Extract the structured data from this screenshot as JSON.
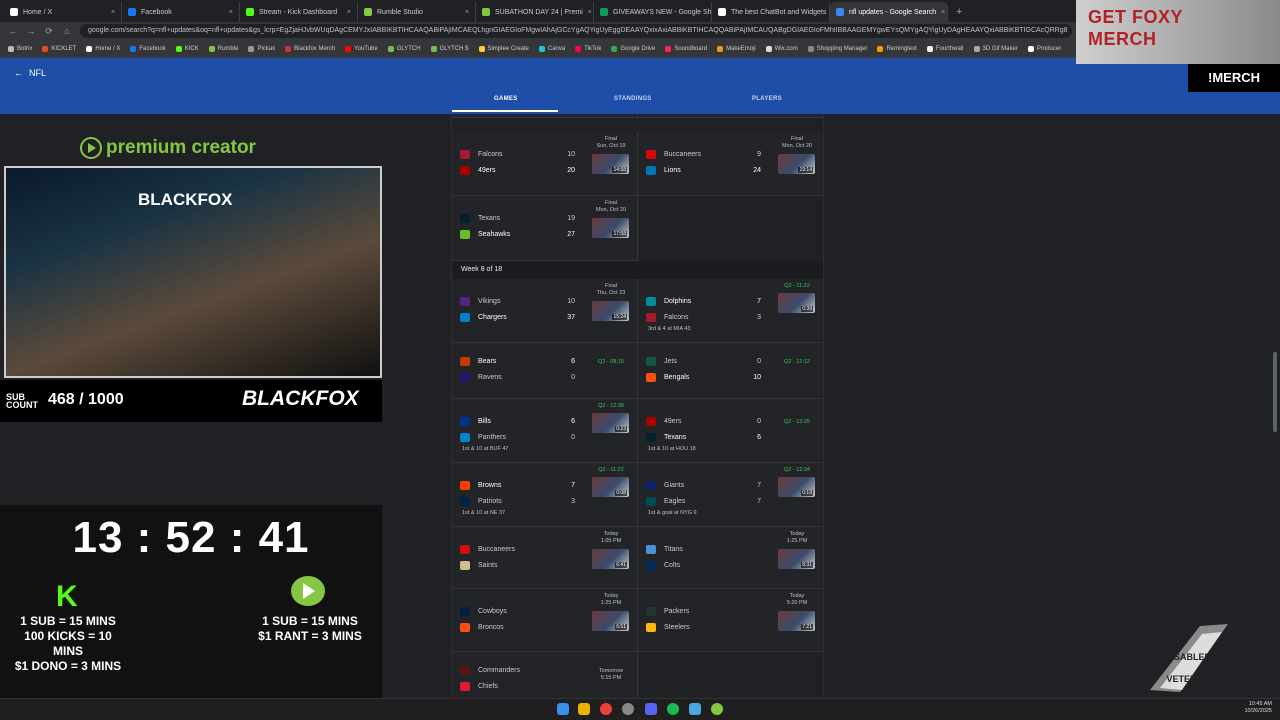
{
  "browser": {
    "tabs": [
      {
        "label": "Home / X",
        "color": "#ffffff"
      },
      {
        "label": "Facebook",
        "color": "#1877f2"
      },
      {
        "label": "Stream - Kick Dashboard",
        "color": "#53fc18"
      },
      {
        "label": "Rumble Studio",
        "color": "#85c742"
      },
      {
        "label": "SUBATHON DAY 24 | Premi",
        "color": "#85c742"
      },
      {
        "label": "GIVEAWAYS NEW - Google She",
        "color": "#0f9d58"
      },
      {
        "label": "The best ChatBot and Widgets",
        "color": "#ffffff"
      },
      {
        "label": "nfl updates - Google Search",
        "color": "#4285f4"
      }
    ],
    "url": "google.com/search?q=nfl+updates&oq=nfl+updates&gs_lcrp=EgZjaHJvbWUqDAgCEMYJxIABBIKBTIHCAAQABiPAjIMCAEQLhgnGIAEGIoFMgwIAhAjGCcYgAQYigUyEggDEAAYQxixAxiABBiKBTIHCAQQABiPAjIMCAUQABgDGIAEGIoFMhIIBBAAGEMYgwEYsQMYgAQYigUyDAgHEAAYQxiABBiKBTIGCAcQRRg8",
    "bookmarks": [
      "Botrix",
      "KICKLET",
      "Home / X",
      "Facebook",
      "KICK",
      "Rumble",
      "Pickax",
      "Blackfox Merch",
      "YouTube",
      "GLYTCH",
      "GLYTCH $",
      "Simplee Create",
      "Canva",
      "TikTok",
      "Google Drive",
      "Soundboard",
      "MakeEmoji",
      "Wix.com",
      "Shopping Manager",
      "Remingtext",
      "Fourthwall",
      "3D Gif Maker",
      "Producer"
    ]
  },
  "sports": {
    "league": "NFL",
    "tabs": [
      "GAMES",
      "STANDINGS",
      "PLAYERS"
    ]
  },
  "scoreboard": {
    "week_label": "Week 8 of 18",
    "games": [
      {
        "teamA": "Falcons",
        "scoreA": "10",
        "teamB": "49ers",
        "scoreB": "20",
        "status1": "Final",
        "status2": "Sun, Oct 19",
        "thumb": "14:58",
        "note": ""
      },
      {
        "teamA": "Buccaneers",
        "scoreA": "9",
        "teamB": "Lions",
        "scoreB": "24",
        "status1": "Final",
        "status2": "Mon, Oct 20",
        "thumb": "19:14",
        "note": ""
      },
      {
        "teamA": "Texans",
        "scoreA": "19",
        "teamB": "Seahawks",
        "scoreB": "27",
        "status1": "Final",
        "status2": "Mon, Oct 20",
        "thumb": "17:58",
        "note": ""
      },
      {
        "teamA": "Vikings",
        "scoreA": "10",
        "teamB": "Chargers",
        "scoreB": "37",
        "status1": "Final",
        "status2": "Thu, Oct 23",
        "thumb": "15:24",
        "note": ""
      },
      {
        "teamA": "Dolphins",
        "scoreA": "7",
        "teamB": "Falcons",
        "scoreB": "3",
        "status1": "Q2 - 11:22",
        "status2": "",
        "thumb": "0:39",
        "note": "3rd & 4 at MIA 43"
      },
      {
        "teamA": "Bears",
        "scoreA": "6",
        "teamB": "Ravens",
        "scoreB": "0",
        "status1": "Q2 - 08:15",
        "status2": "",
        "thumb": "",
        "note": ""
      },
      {
        "teamA": "Jets",
        "scoreA": "0",
        "teamB": "Bengals",
        "scoreB": "10",
        "status1": "Q2 - 12:12",
        "status2": "",
        "thumb": "",
        "note": ""
      },
      {
        "teamA": "Bills",
        "scoreA": "6",
        "teamB": "Panthers",
        "scoreB": "0",
        "status1": "Q2 - 12:39",
        "status2": "",
        "thumb": "0:23",
        "note": "1st & 10 at BUF 47"
      },
      {
        "teamA": "49ers",
        "scoreA": "0",
        "teamB": "Texans",
        "scoreB": "6",
        "status1": "Q2 - 13:25",
        "status2": "",
        "thumb": "",
        "note": "1st & 10 at HOU 18"
      },
      {
        "teamA": "Browns",
        "scoreA": "7",
        "teamB": "Patriots",
        "scoreB": "3",
        "status1": "Q2 - 11:22",
        "status2": "",
        "thumb": "0:08",
        "note": "1st & 10 at NE 37"
      },
      {
        "teamA": "Giants",
        "scoreA": "7",
        "teamB": "Eagles",
        "scoreB": "7",
        "status1": "Q2 - 12:34",
        "status2": "",
        "thumb": "0:19",
        "note": "1st & goal at NYG 9"
      },
      {
        "teamA": "Buccaneers",
        "scoreA": "",
        "teamB": "Saints",
        "scoreB": "",
        "status1": "Today",
        "status2": "1:05 PM",
        "thumb": "6:41",
        "note": ""
      },
      {
        "teamA": "Titans",
        "scoreA": "",
        "teamB": "Colts",
        "scoreB": "",
        "status1": "Today",
        "status2": "1:25 PM",
        "thumb": "8:31",
        "note": ""
      },
      {
        "teamA": "Cowboys",
        "scoreA": "",
        "teamB": "Broncos",
        "scoreB": "",
        "status1": "Today",
        "status2": "1:25 PM",
        "thumb": "6:51",
        "note": ""
      },
      {
        "teamA": "Packers",
        "scoreA": "",
        "teamB": "Steelers",
        "scoreB": "",
        "status1": "Today",
        "status2": "5:20 PM",
        "thumb": "7:21",
        "note": ""
      },
      {
        "teamA": "Commanders",
        "scoreA": "",
        "teamB": "Chiefs",
        "scoreB": "",
        "status1": "Tomorrow",
        "status2": "5:15 PM",
        "thumb": "",
        "note": ""
      }
    ]
  },
  "overlay": {
    "premium_label": "premium creator",
    "cam_brand": "BLACKFOX",
    "sub_small": "SUB COUNT",
    "sub_count": "468 / 1000",
    "sub_brand": "BLACKFOX",
    "timer": "13 : 52 : 41",
    "kick_rates": "1 SUB = 15 MINS\n100 KICKS = 10 MINS\n$1 DONO = 3 MINS",
    "rumble_rates": "1 SUB = 15 MINS\n$1 RANT = 3 MINS",
    "merch_title": "GET FOXY MERCH",
    "merch_command": "!MERCH",
    "badge_text": "DISABLED VETERAN"
  },
  "taskbar": {
    "time": "10:45 AM",
    "date": "10/26/2025"
  },
  "colors": {
    "sports_header": "#1f4ea8",
    "live_green": "#34c759",
    "kick_green": "#53fc18",
    "rumble_green": "#85c742",
    "merch_red": "#b12228"
  }
}
